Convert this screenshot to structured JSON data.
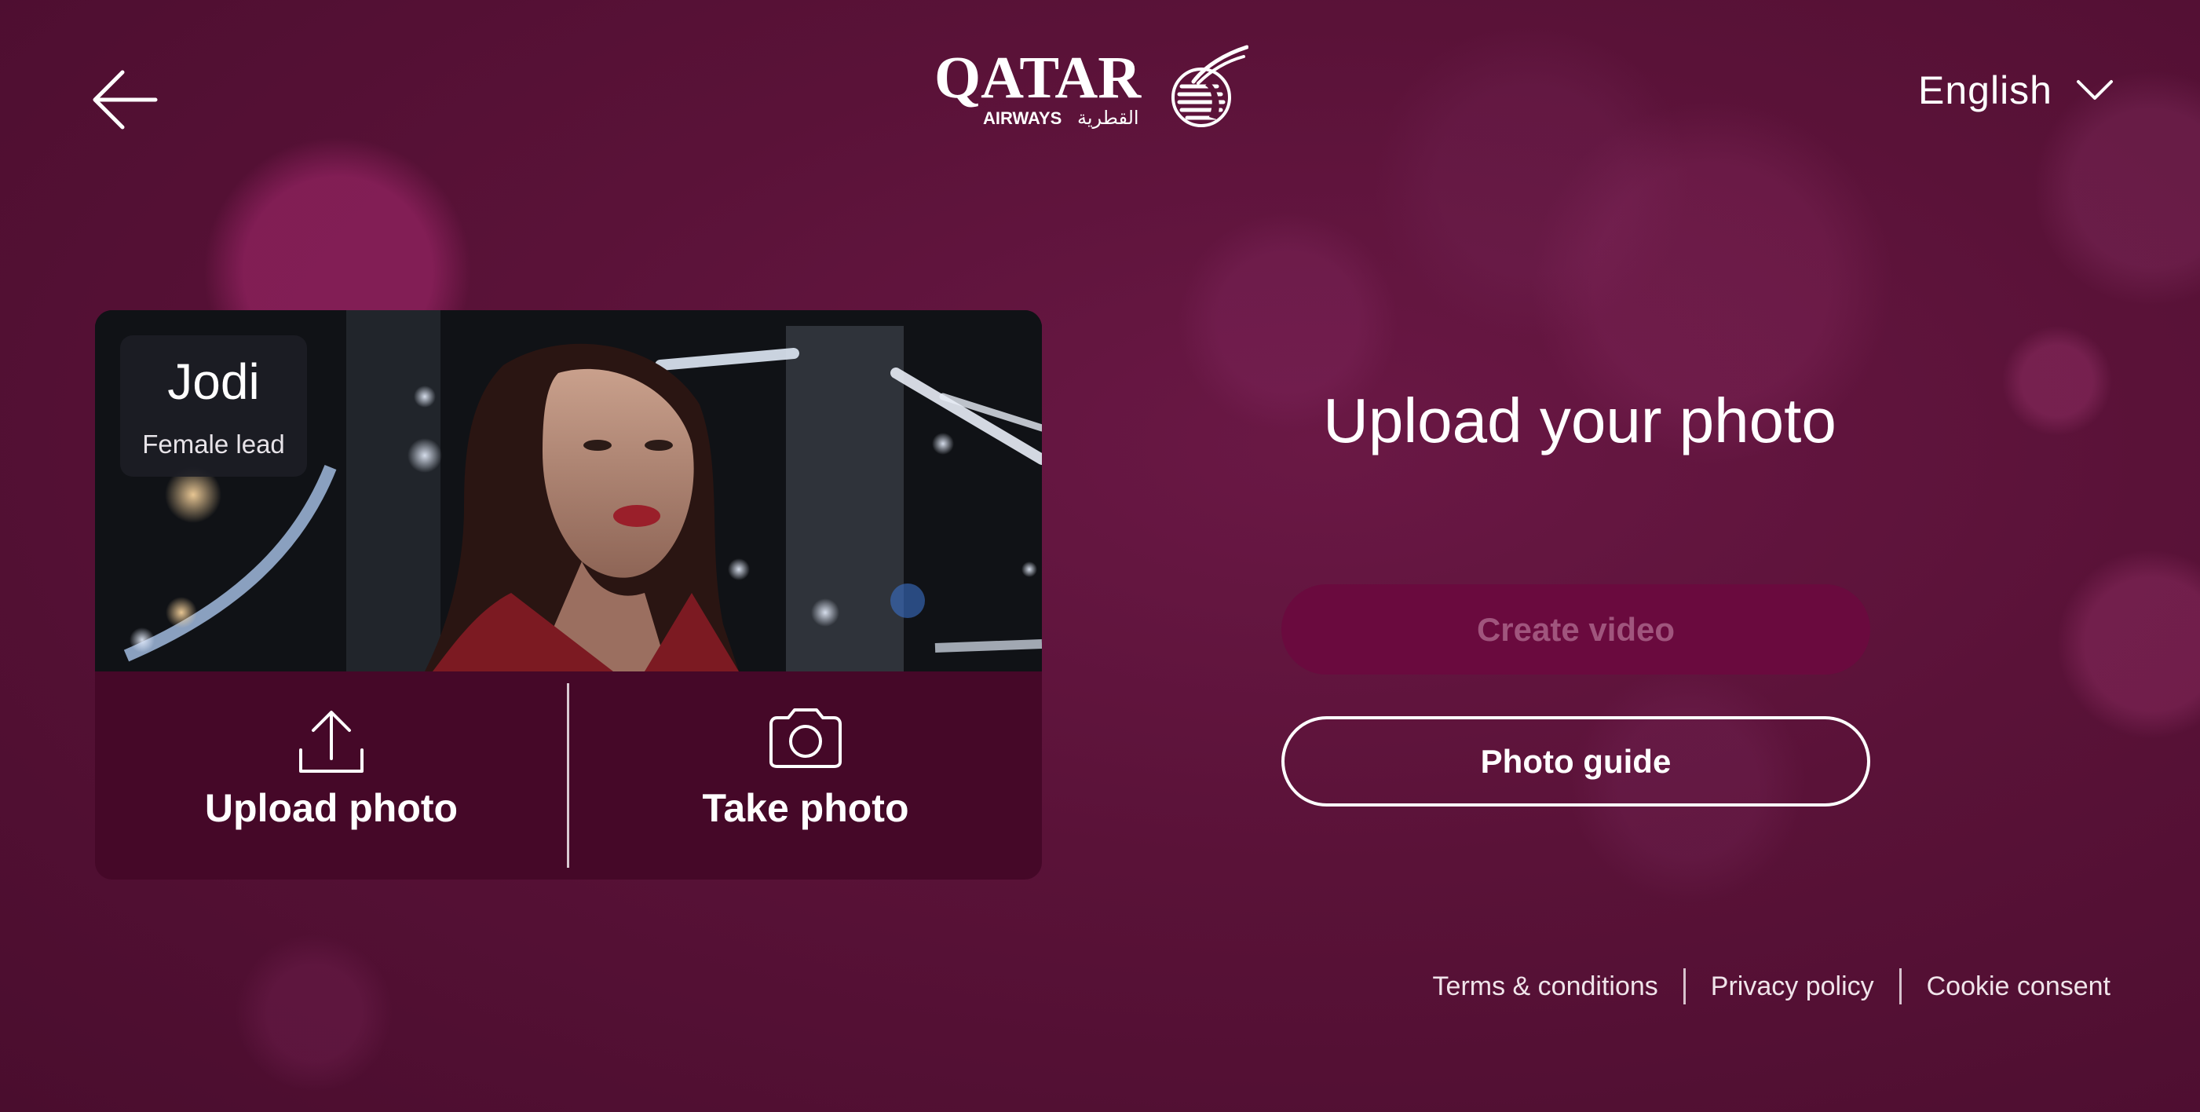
{
  "header": {
    "back_icon": "arrow-left-icon",
    "logo_text": "QATAR",
    "logo_sub_text": "AIRWAYS",
    "logo_arabic_text": "القطرية",
    "language_label": "English",
    "language_icon": "chevron-down-icon"
  },
  "character": {
    "name": "Jodi",
    "role": "Female lead"
  },
  "actions": {
    "upload_label": "Upload photo",
    "upload_icon": "upload-icon",
    "take_label": "Take photo",
    "take_icon": "camera-icon"
  },
  "main": {
    "title": "Upload your photo",
    "create_video_label": "Create video",
    "photo_guide_label": "Photo guide"
  },
  "footer": {
    "links": [
      "Terms & conditions",
      "Privacy policy",
      "Cookie consent"
    ]
  },
  "colors": {
    "background": "#5a1238",
    "card": "#450828",
    "create_button_disabled": "#6a0a3e"
  }
}
